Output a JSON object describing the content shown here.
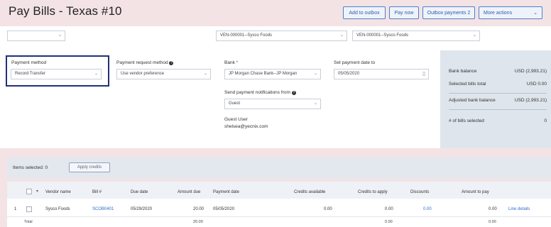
{
  "page": {
    "title": "Pay Bills - Texas #10"
  },
  "toolbar": {
    "add_outbox": "Add to outbox",
    "pay_now": "Pay now",
    "outbox_payments": "Outbox payments 2",
    "more_actions": "More actions"
  },
  "filters": {
    "first": "",
    "vendor_one": "VEN-000001--Sysco Foods",
    "vendor_two": "VEN-000001--Sysco Foods"
  },
  "form": {
    "payment_method_label": "Payment method",
    "payment_method_value": "Record Transfer",
    "request_method_label": "Payment request method",
    "request_method_value": "Use vendor preference",
    "bank_label": "Bank",
    "bank_required": "*",
    "bank_value": "JP Morgan Chase Bank--JP Morgan",
    "date_label": "Set payment date to",
    "date_value": "05/05/2020",
    "notify_label": "Send payment notifications from",
    "notify_value": "Guest",
    "guest_name": "Guest User",
    "guest_email": "shelsea@yecnix.com"
  },
  "summary": {
    "bank_balance_label": "Bank balance",
    "bank_balance_value": "USD (2,993.21)",
    "selected_label": "Selected bills total",
    "selected_value": "USD 0.00",
    "adjusted_label": "Adjusted bank balance",
    "adjusted_value": "USD (2,993.21)",
    "count_label": "# of bills selected",
    "count_value": "0"
  },
  "items": {
    "selected_label": "Items selected: 0",
    "apply_credits": "Apply credits"
  },
  "table": {
    "headers": [
      "Vendor name",
      "Bill #",
      "Due date",
      "Amount due",
      "Payment date",
      "Credits available",
      "Credits to apply",
      "Discounts",
      "Amount to pay"
    ],
    "rows": [
      {
        "num": "1",
        "vendor": "Sysco Foods",
        "bill": "SCOB0401",
        "due": "05/29/2020",
        "amount_due": "20.00",
        "pay_date": "05/05/2020",
        "credits_available": "0.00",
        "credits_apply": "0.00",
        "discounts": "0.00",
        "amount_pay": "0.00",
        "action": "Line details"
      }
    ],
    "total_label": "Total",
    "total_amount_due": "20.00",
    "total_credits_apply": "0.00",
    "total_amount_pay": "0.00"
  },
  "colors": {
    "accent": "#2e5ea6",
    "focus_border": "#22307a",
    "side_panel": "#dfe5ec"
  }
}
